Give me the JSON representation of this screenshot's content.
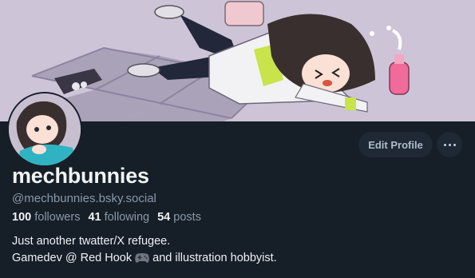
{
  "profile": {
    "display_name": "mechbunnies",
    "handle": "@mechbunnies.bsky.social",
    "stats": {
      "followers_count": "100",
      "followers_label": "followers",
      "following_count": "41",
      "following_label": "following",
      "posts_count": "54",
      "posts_label": "posts"
    },
    "bio_line1": "Just another twatter/X refugee.",
    "bio_line2_before": "Gamedev @ Red Hook",
    "bio_line2_after": "and illustration hobbyist."
  },
  "actions": {
    "edit_label": "Edit Profile"
  },
  "icons": {
    "more": "more-horizontal-icon",
    "controller": "game-controller-emoji"
  },
  "colors": {
    "background": "#161e27",
    "button_bg": "#1e2935",
    "muted_text": "#8a99a8",
    "primary_text": "#f1f3f5"
  }
}
